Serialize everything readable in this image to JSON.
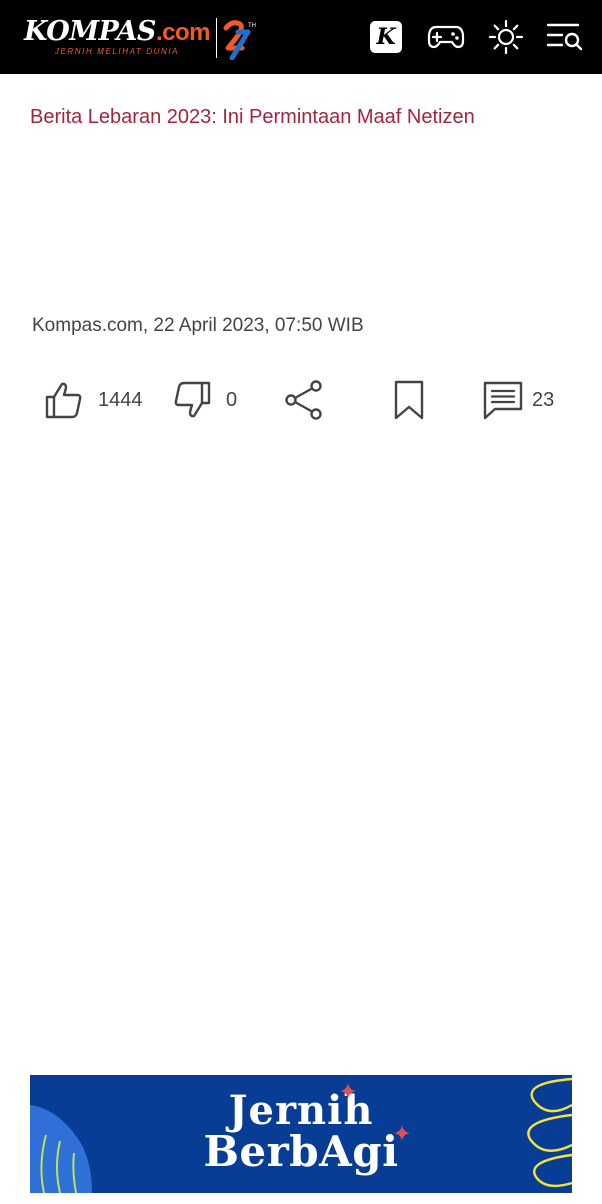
{
  "header": {
    "logo_brand": "KOMPAS",
    "logo_suffix": ".com",
    "logo_tagline": "JERNIH MELIHAT DUNIA",
    "icons": [
      "kompas-k-icon",
      "gamepad-icon",
      "sun-icon",
      "menu-search-icon"
    ],
    "k_glyph": "K"
  },
  "article": {
    "headline": "Berita Lebaran 2023: Ini Permintaan Maaf Netizen",
    "meta": "Kompas.com, 22 April 2023, 07:50 WIB"
  },
  "actions": {
    "likes": "1444",
    "dislikes": "0",
    "comments": "23"
  },
  "banner": {
    "line1": "Jernih",
    "line2": "BerbAgi"
  },
  "colors": {
    "header_bg": "#000000",
    "accent_orange": "#f15a24",
    "headline": "#a5243d",
    "banner_bg": "#083d96",
    "banner_yellow": "#f2e33a"
  }
}
